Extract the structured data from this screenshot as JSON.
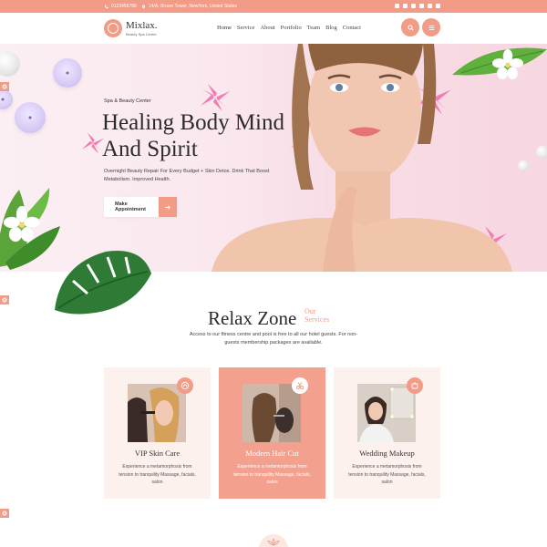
{
  "topbar": {
    "phone": "0123456789",
    "address": "14/A, Brown Tower, NewYork, United States",
    "socials": [
      "facebook-icon",
      "twitter-icon",
      "linkedin-icon",
      "instagram-icon",
      "google-plus-icon",
      "email-icon"
    ]
  },
  "header": {
    "logo_name": "Mixlax.",
    "logo_tagline": "Beauty Spa Center",
    "nav": [
      "Home",
      "Service",
      "About",
      "Portfolio",
      "Team",
      "Blog",
      "Contact"
    ]
  },
  "hero": {
    "tag": "Spa & Beauty Center",
    "title": "Healing Body Mind And Spirit",
    "text": "Overnight Beauty Repair For Every Budget + Skin Detox. Drink That Boost Metabolism. Improved Health.",
    "button": "Make Appointment"
  },
  "section": {
    "title": "Relax Zone",
    "subtitle": "Our Services",
    "text": "Access to our fitness centre and pool is free to all our hotel guests. For non-guests membership packages are available."
  },
  "cards": [
    {
      "title": "VIP Skin Care",
      "text": "Experience a metamorphosis from tension to tranquility Massage, facials, salon"
    },
    {
      "title": "Modern Hair Cut",
      "text": "Experience a metamorphosis from tension to tranquility Massage, facials, salon"
    },
    {
      "title": "Wedding Makeup",
      "text": "Experience a metamorphosis from tension to tranquility Massage, facials, salon"
    }
  ],
  "colors": {
    "accent": "#f29b86",
    "hero_bg": "#f8dde6",
    "card_bg": "#fdf1ee"
  }
}
